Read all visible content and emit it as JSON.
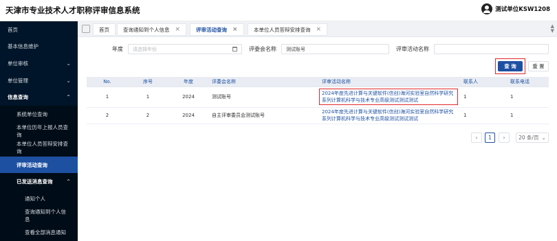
{
  "header": {
    "app_title": "天津市专业技术人才职称评审信息系统",
    "user_name": "测试单位KSW1208"
  },
  "sidebar": {
    "items": [
      {
        "label": "首页",
        "chevron": ""
      },
      {
        "label": "基本信息维护",
        "chevron": ""
      },
      {
        "label": "单位审核",
        "chevron": "⌄"
      },
      {
        "label": "单位管理",
        "chevron": "⌄"
      },
      {
        "label": "信息查询",
        "chevron": "⌃"
      },
      {
        "label": "系统单位查询",
        "chevron": ""
      },
      {
        "label": "本单位历年上报人员查询",
        "chevron": ""
      },
      {
        "label": "本单位人员答辩安排查询",
        "chevron": ""
      },
      {
        "label": "评审活动查询",
        "chevron": ""
      },
      {
        "label": "已发送消息查询",
        "chevron": "⌃"
      },
      {
        "label": "通知个人",
        "chevron": ""
      },
      {
        "label": "查询通知到个人信息",
        "chevron": ""
      },
      {
        "label": "查看全部消息通知",
        "chevron": ""
      }
    ]
  },
  "tabs": [
    {
      "label": "首页",
      "close": ""
    },
    {
      "label": "查询通知到个人信息",
      "close": "×"
    },
    {
      "label": "评审活动查询",
      "close": "×"
    },
    {
      "label": "本单位人员答辩安排查询",
      "close": "×"
    }
  ],
  "filters": {
    "year_label": "年度",
    "year_placeholder": "请选择年份",
    "committee_label": "评委会名称",
    "committee_value": "测试账号",
    "activity_label": "评审活动名称",
    "activity_value": ""
  },
  "buttons": {
    "query": "查 询",
    "reset": "重 置"
  },
  "table": {
    "headers": [
      "No.",
      "序号",
      "年度",
      "评委会名称",
      "评审活动名称",
      "联系人",
      "联系电话"
    ],
    "rows": [
      {
        "no": "1",
        "seq": "1",
        "year": "2024",
        "committee": "测试账号",
        "activity": "2024年度先进计算与关键软件(信创)海河实验室自然科学研究系列计算机科学与技术专业高级测试测试测试",
        "contact": "1",
        "phone": "1"
      },
      {
        "no": "2",
        "seq": "2",
        "year": "2024",
        "committee": "自主评审委员会测试账号",
        "activity": "2024年度先进计算与关键软件(信创)海河实验室自然科学研究系列计算机科学与技术专业高级测试测试测试",
        "contact": "1",
        "phone": "1"
      }
    ]
  },
  "pagination": {
    "prev": "‹",
    "page": "1",
    "next": "›",
    "page_size": "20 条/页"
  },
  "icons": {
    "avatar": "user-avatar-icon",
    "calendar": "calendar-icon"
  }
}
